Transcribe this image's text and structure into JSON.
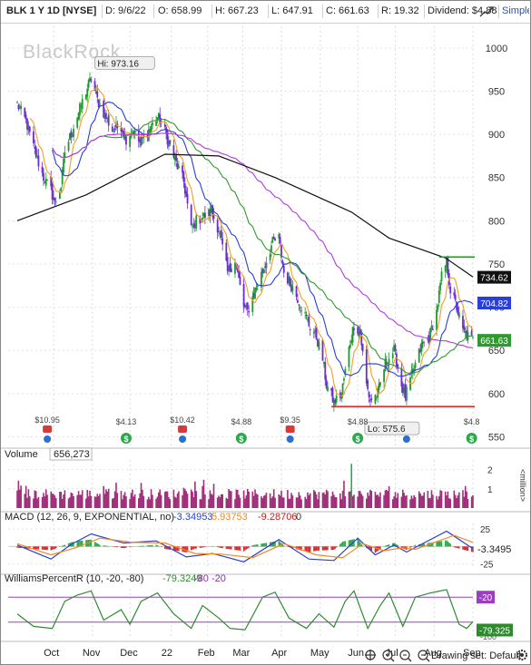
{
  "header": {
    "symbol": "BLK 1 Y 1D [NYSE]",
    "date": "D: 9/6/22",
    "open": "O: 658.99",
    "high": "H: 667.23",
    "low": "L: 647.91",
    "close": "C: 661.63",
    "range": "R: 19.32",
    "dividend": "Dividend: $4.88",
    "style_label": "Simple...",
    "fullscreen_icon": "chart-expand-icon"
  },
  "watermark": "BlackRock",
  "footer": {
    "drawing_set": "Drawing set: Default"
  },
  "chart_data": [
    {
      "type": "candlestick",
      "title": "BLK 1 Y 1D [NYSE]",
      "ylim": [
        540,
        1025
      ],
      "y_ticks": [
        550,
        600,
        650,
        700,
        750,
        800,
        850,
        900,
        950,
        1000
      ],
      "x_labels": [
        "Oct",
        "Nov",
        "Dec",
        "22",
        "Feb",
        "Mar",
        "Apr",
        "May",
        "Jun",
        "Jul",
        "Aug",
        "Sep"
      ],
      "close_path": [
        [
          "2021-09-07",
          935
        ],
        [
          "2021-09-14",
          915
        ],
        [
          "2021-09-21",
          880
        ],
        [
          "2021-09-28",
          850
        ],
        [
          "2021-10-04",
          835
        ],
        [
          "2021-10-07",
          820
        ],
        [
          "2021-10-12",
          840
        ],
        [
          "2021-10-15",
          880
        ],
        [
          "2021-10-21",
          905
        ],
        [
          "2021-10-26",
          925
        ],
        [
          "2021-11-01",
          950
        ],
        [
          "2021-11-05",
          965
        ],
        [
          "2021-11-10",
          940
        ],
        [
          "2021-11-15",
          925
        ],
        [
          "2021-11-22",
          905
        ],
        [
          "2021-11-29",
          910
        ],
        [
          "2021-12-03",
          895
        ],
        [
          "2021-12-08",
          905
        ],
        [
          "2021-12-14",
          890
        ],
        [
          "2021-12-21",
          905
        ],
        [
          "2021-12-28",
          920
        ],
        [
          "2021-12-31",
          915
        ],
        [
          "2022-01-05",
          895
        ],
        [
          "2022-01-11",
          870
        ],
        [
          "2022-01-18",
          845
        ],
        [
          "2022-01-24",
          790
        ],
        [
          "2022-01-28",
          800
        ],
        [
          "2022-02-03",
          805
        ],
        [
          "2022-02-09",
          810
        ],
        [
          "2022-02-15",
          790
        ],
        [
          "2022-02-22",
          740
        ],
        [
          "2022-02-28",
          755
        ],
        [
          "2022-03-07",
          700
        ],
        [
          "2022-03-10",
          695
        ],
        [
          "2022-03-16",
          720
        ],
        [
          "2022-03-23",
          745
        ],
        [
          "2022-03-30",
          775
        ],
        [
          "2022-04-04",
          780
        ],
        [
          "2022-04-08",
          740
        ],
        [
          "2022-04-14",
          725
        ],
        [
          "2022-04-21",
          705
        ],
        [
          "2022-04-28",
          680
        ],
        [
          "2022-05-04",
          665
        ],
        [
          "2022-05-09",
          640
        ],
        [
          "2022-05-12",
          610
        ],
        [
          "2022-05-18",
          590
        ],
        [
          "2022-05-24",
          600
        ],
        [
          "2022-05-31",
          660
        ],
        [
          "2022-06-03",
          680
        ],
        [
          "2022-06-08",
          670
        ],
        [
          "2022-06-13",
          610
        ],
        [
          "2022-06-16",
          592
        ],
        [
          "2022-06-22",
          600
        ],
        [
          "2022-06-28",
          635
        ],
        [
          "2022-07-05",
          650
        ],
        [
          "2022-07-11",
          610
        ],
        [
          "2022-07-14",
          597
        ],
        [
          "2022-07-20",
          625
        ],
        [
          "2022-07-27",
          655
        ],
        [
          "2022-08-02",
          665
        ],
        [
          "2022-08-08",
          695
        ],
        [
          "2022-08-12",
          735
        ],
        [
          "2022-08-16",
          752
        ],
        [
          "2022-08-19",
          720
        ],
        [
          "2022-08-24",
          700
        ],
        [
          "2022-08-29",
          672
        ],
        [
          "2022-09-06",
          662
        ]
      ],
      "moving_averages": [
        {
          "color": "#f2a020",
          "note": "short SMA (orange)"
        },
        {
          "color": "#2a3fd8",
          "note": "SMA (blue)"
        },
        {
          "color": "#2f9a2f",
          "note": "SMA (green)"
        },
        {
          "color": "#b23be0",
          "note": "SMA (purple)"
        },
        {
          "color": "#111111",
          "note": "SMA (black)",
          "points": [
            [
              "2021-09-07",
              800
            ],
            [
              "2021-11-01",
              830
            ],
            [
              "2022-01-03",
              877
            ],
            [
              "2022-02-15",
              875
            ],
            [
              "2022-04-01",
              850
            ],
            [
              "2022-06-01",
              810
            ],
            [
              "2022-07-01",
              780
            ],
            [
              "2022-08-15",
              757
            ],
            [
              "2022-09-06",
              735
            ]
          ]
        }
      ],
      "horizontal_lines": [
        {
          "value": 758,
          "color": "#1a9f1a"
        },
        {
          "value": 585,
          "color": "#d61a1a"
        }
      ],
      "annotations": [
        {
          "label": "Hi: 973.16",
          "date": "2021-11-05",
          "value": 973.16
        },
        {
          "label": "Lo: 575.6",
          "date": "2022-06-16",
          "value": 575.6
        }
      ],
      "price_badges": [
        {
          "value": 734.62,
          "label": "734.62",
          "bg": "#111111"
        },
        {
          "value": 704.82,
          "label": "704.82",
          "bg": "#2a3fd8"
        },
        {
          "value": 661.63,
          "label": "661.63",
          "bg": "#2f9a2f"
        }
      ],
      "events": [
        {
          "date": "2021-10-01",
          "kind": "earnings",
          "label": "$10.95"
        },
        {
          "date": "2021-10-01",
          "kind": "info"
        },
        {
          "date": "2021-12-03",
          "kind": "dividend",
          "label": "$4.13"
        },
        {
          "date": "2022-01-17",
          "kind": "earnings",
          "label": "$10.42"
        },
        {
          "date": "2022-01-17",
          "kind": "info"
        },
        {
          "date": "2022-03-05",
          "kind": "dividend",
          "label": "$4.88"
        },
        {
          "date": "2022-04-13",
          "kind": "earnings",
          "label": "$9.35"
        },
        {
          "date": "2022-04-13",
          "kind": "info"
        },
        {
          "date": "2022-06-06",
          "kind": "dividend",
          "label": "$4.88"
        },
        {
          "date": "2022-07-15",
          "kind": "info"
        },
        {
          "date": "2022-09-05",
          "kind": "dividend",
          "label": "$4.8"
        }
      ]
    },
    {
      "type": "bar",
      "title": "Volume",
      "value_label": "656,273",
      "ylim": [
        0,
        2500000
      ],
      "y_ticks": [
        {
          "value": 1000000,
          "label": "1"
        },
        {
          "value": 2000000,
          "label": "2"
        }
      ],
      "unit_label": "<million>",
      "highlight_spike": {
        "date": "2022-06-01",
        "value": 2300000
      },
      "color": "#a0307a"
    },
    {
      "type": "line",
      "title": "MACD (12, 26, 9, EXPONENTIAL, no)",
      "values_shown": [
        "-3.34953",
        "5.93753",
        "-9.28706",
        "0"
      ],
      "ylim": [
        -32,
        33
      ],
      "y_ticks": [
        {
          "value": 25,
          "label": "25"
        },
        {
          "value": -25,
          "label": "-25"
        }
      ],
      "value_badge": "-3.3495",
      "series": [
        {
          "name": "MACD",
          "color": "#2a3fd8",
          "points": [
            [
              "2021-09-07",
              2
            ],
            [
              "2021-10-04",
              -18
            ],
            [
              "2021-10-20",
              3
            ],
            [
              "2021-11-05",
              18
            ],
            [
              "2021-12-01",
              5
            ],
            [
              "2021-12-27",
              8
            ],
            [
              "2022-01-20",
              -15
            ],
            [
              "2022-02-10",
              -10
            ],
            [
              "2022-03-07",
              -22
            ],
            [
              "2022-04-04",
              10
            ],
            [
              "2022-04-28",
              -18
            ],
            [
              "2022-05-18",
              -20
            ],
            [
              "2022-06-06",
              12
            ],
            [
              "2022-06-20",
              -12
            ],
            [
              "2022-07-05",
              2
            ],
            [
              "2022-07-15",
              -8
            ],
            [
              "2022-08-16",
              22
            ],
            [
              "2022-09-06",
              -3
            ]
          ]
        },
        {
          "name": "Signal",
          "color": "#f08a24",
          "points": [
            [
              "2021-09-07",
              4
            ],
            [
              "2021-10-04",
              -12
            ],
            [
              "2021-10-25",
              -1
            ],
            [
              "2021-11-12",
              12
            ],
            [
              "2021-12-08",
              6
            ],
            [
              "2022-01-03",
              5
            ],
            [
              "2022-01-27",
              -10
            ],
            [
              "2022-02-17",
              -11
            ],
            [
              "2022-03-14",
              -16
            ],
            [
              "2022-04-08",
              4
            ],
            [
              "2022-05-04",
              -12
            ],
            [
              "2022-05-25",
              -16
            ],
            [
              "2022-06-10",
              4
            ],
            [
              "2022-06-27",
              -6
            ],
            [
              "2022-07-12",
              -2
            ],
            [
              "2022-07-22",
              -4
            ],
            [
              "2022-08-22",
              16
            ],
            [
              "2022-09-06",
              6
            ]
          ]
        }
      ]
    },
    {
      "type": "line",
      "title": "WilliamsPercentR (10, -20, -80)",
      "values_shown": [
        "-79.3249",
        "-80",
        "-20"
      ],
      "ylim": [
        -100,
        0
      ],
      "reference_lines": [
        {
          "value": -20,
          "label": "-20"
        },
        {
          "value": -80,
          "label": "-80"
        }
      ],
      "value_badge": "-79.325",
      "axis_label_bottom": "-100",
      "series": [
        {
          "name": "%R",
          "color": "#2f8a2f",
          "points": [
            [
              "2021-09-07",
              -60
            ],
            [
              "2021-09-20",
              -90
            ],
            [
              "2021-10-05",
              -95
            ],
            [
              "2021-10-15",
              -30
            ],
            [
              "2021-10-25",
              -15
            ],
            [
              "2021-11-05",
              -5
            ],
            [
              "2021-11-15",
              -75
            ],
            [
              "2021-11-29",
              -50
            ],
            [
              "2021-12-06",
              -85
            ],
            [
              "2021-12-15",
              -30
            ],
            [
              "2021-12-28",
              -10
            ],
            [
              "2022-01-10",
              -60
            ],
            [
              "2022-01-24",
              -95
            ],
            [
              "2022-02-02",
              -40
            ],
            [
              "2022-02-15",
              -70
            ],
            [
              "2022-02-24",
              -95
            ],
            [
              "2022-03-08",
              -98
            ],
            [
              "2022-03-22",
              -20
            ],
            [
              "2022-04-01",
              -8
            ],
            [
              "2022-04-12",
              -70
            ],
            [
              "2022-04-26",
              -95
            ],
            [
              "2022-05-06",
              -60
            ],
            [
              "2022-05-18",
              -92
            ],
            [
              "2022-05-27",
              -30
            ],
            [
              "2022-06-03",
              -5
            ],
            [
              "2022-06-14",
              -95
            ],
            [
              "2022-06-24",
              -40
            ],
            [
              "2022-07-01",
              -10
            ],
            [
              "2022-07-12",
              -90
            ],
            [
              "2022-07-22",
              -20
            ],
            [
              "2022-08-03",
              -10
            ],
            [
              "2022-08-16",
              -2
            ],
            [
              "2022-08-26",
              -85
            ],
            [
              "2022-09-01",
              -95
            ],
            [
              "2022-09-06",
              -79
            ]
          ]
        }
      ]
    }
  ]
}
